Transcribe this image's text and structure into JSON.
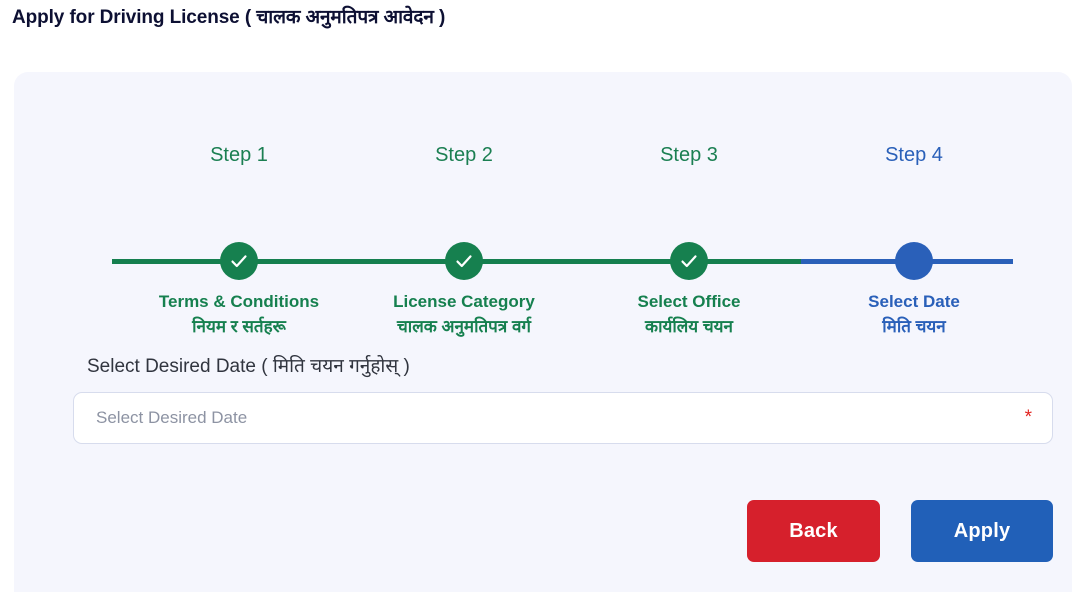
{
  "header": {
    "title": "Apply for Driving License ( चालक अनुमतिपत्र आवेदन )"
  },
  "stepper": {
    "steps": [
      {
        "number": "Step 1",
        "label_en": "Terms & Conditions",
        "label_np": "नियम र सर्तहरू",
        "state": "completed",
        "icon": "check-icon",
        "color": "#16804f"
      },
      {
        "number": "Step 2",
        "label_en": "License Category",
        "label_np": "चालक अनुमतिपत्र वर्ग",
        "state": "completed",
        "icon": "check-icon",
        "color": "#16804f"
      },
      {
        "number": "Step 3",
        "label_en": "Select Office",
        "label_np": "कार्यलिय चयन",
        "state": "completed",
        "icon": "check-icon",
        "color": "#16804f"
      },
      {
        "number": "Step 4",
        "label_en": "Select Date",
        "label_np": "मिति चयन",
        "state": "active",
        "icon": "filled-dot-icon",
        "color": "#2a60b9"
      }
    ]
  },
  "form": {
    "date_field": {
      "label": "Select Desired Date ( मिति चयन गर्नुहोस् )",
      "placeholder": "Select Desired Date",
      "value": "",
      "required_marker": "*",
      "required_color": "#e2231f"
    }
  },
  "actions": {
    "back_label": "Back",
    "back_color": "#d6202c",
    "apply_label": "Apply",
    "apply_color": "#2160b8"
  }
}
